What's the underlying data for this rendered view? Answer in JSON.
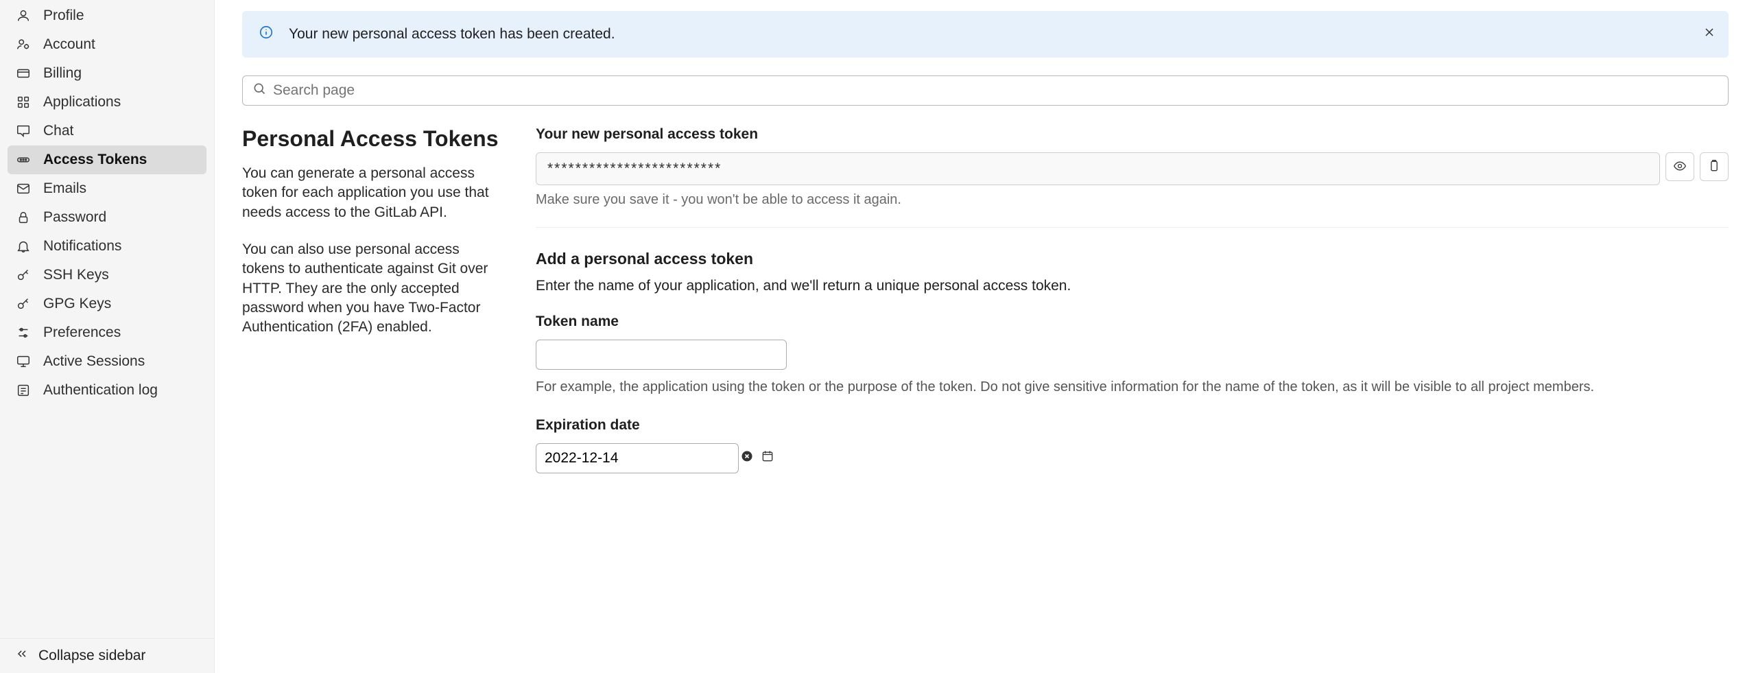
{
  "sidebar": {
    "items": [
      {
        "label": "Profile",
        "icon": "profile"
      },
      {
        "label": "Account",
        "icon": "account"
      },
      {
        "label": "Billing",
        "icon": "billing"
      },
      {
        "label": "Applications",
        "icon": "applications"
      },
      {
        "label": "Chat",
        "icon": "chat"
      },
      {
        "label": "Access Tokens",
        "icon": "token"
      },
      {
        "label": "Emails",
        "icon": "emails"
      },
      {
        "label": "Password",
        "icon": "password"
      },
      {
        "label": "Notifications",
        "icon": "notifications"
      },
      {
        "label": "SSH Keys",
        "icon": "key"
      },
      {
        "label": "GPG Keys",
        "icon": "key"
      },
      {
        "label": "Preferences",
        "icon": "preferences"
      },
      {
        "label": "Active Sessions",
        "icon": "sessions"
      },
      {
        "label": "Authentication log",
        "icon": "authlog"
      }
    ],
    "active_index": 5,
    "collapse_label": "Collapse sidebar"
  },
  "alert": {
    "message": "Your new personal access token has been created."
  },
  "search": {
    "placeholder": "Search page"
  },
  "left": {
    "title": "Personal Access Tokens",
    "p1": "You can generate a personal access token for each application you use that needs access to the GitLab API.",
    "p2": "You can also use personal access tokens to authenticate against Git over HTTP. They are the only accepted password when you have Two-Factor Authentication (2FA) enabled."
  },
  "token": {
    "heading": "Your new personal access token",
    "masked_value": "*************************",
    "save_hint": "Make sure you save it - you won't be able to access it again."
  },
  "add": {
    "heading": "Add a personal access token",
    "desc": "Enter the name of your application, and we'll return a unique personal access token.",
    "name_label": "Token name",
    "name_value": "",
    "name_help": "For example, the application using the token or the purpose of the token. Do not give sensitive information for the name of the token, as it will be visible to all project members.",
    "expiry_label": "Expiration date",
    "expiry_value": "2022-12-14"
  }
}
